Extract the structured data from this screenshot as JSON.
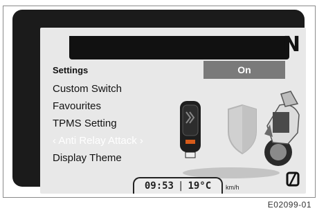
{
  "display": {
    "gear": "N",
    "menu_title": "Settings",
    "menu_items": [
      "Custom Switch",
      "Favourites",
      "TPMS Setting",
      "‹ Anti Relay Attack ›",
      "Display Theme"
    ],
    "selected_item_index": 3,
    "value": "On",
    "time": "09:53",
    "temperature": "19°C",
    "speed_unit": "km/h"
  },
  "figure_ref": "E02099-01",
  "icons": [
    "key-fob-icon",
    "shield-icon",
    "motorcycle-icon",
    "crossed-zero-icon"
  ],
  "colors": {
    "bezel": "#1b1b1b",
    "screen": "#e8e8e8",
    "value_box": "#7a7a7a",
    "text": "#111111"
  }
}
